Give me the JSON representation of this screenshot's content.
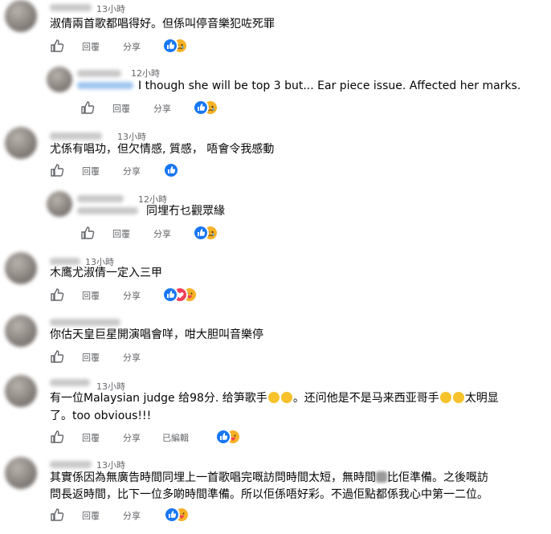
{
  "actions": {
    "like_icon": "thumbs-up-icon",
    "reply": "回覆",
    "share": "分享",
    "edited": "已編輯"
  },
  "comments": [
    {
      "time": "13小時",
      "text": "淑倩兩首歌都唱得好。但係叫停音樂犯咗死罪"
    },
    {
      "time": "12小時",
      "text": "I though she will be top 3 but... Ear piece issue. Affected her marks."
    },
    {
      "time": "13小時",
      "text": "尤係有唱功，但欠情感, 質感， 唔會令我感動"
    },
    {
      "time": "12小時",
      "text": "同埋冇乜觀眾緣"
    },
    {
      "time": "13小時",
      "text": "木鹰尤淑倩一定入三甲"
    },
    {
      "time": "",
      "text": "你估天皇巨星開演唱會咩，咁大胆叫音樂停"
    },
    {
      "time": "13小時",
      "text_a": "有一位Malaysian judge 给98分. 给笋歌手",
      "text_b": "。还问他是不是马来西亚哥手",
      "text_c": "太明显",
      "text_d": "了。too obvious!!!"
    },
    {
      "time": "13小時",
      "text_a": "其實係因為無廣告時間同埋上一首歌唱完嘅訪問時間太短，無時間",
      "text_b": "比佢準備。之後嘅訪",
      "text_c": "問長返時間，比下一位多啲時間準備。所以佢係唔好彩。不過佢點都係我心中第一二位。"
    }
  ]
}
